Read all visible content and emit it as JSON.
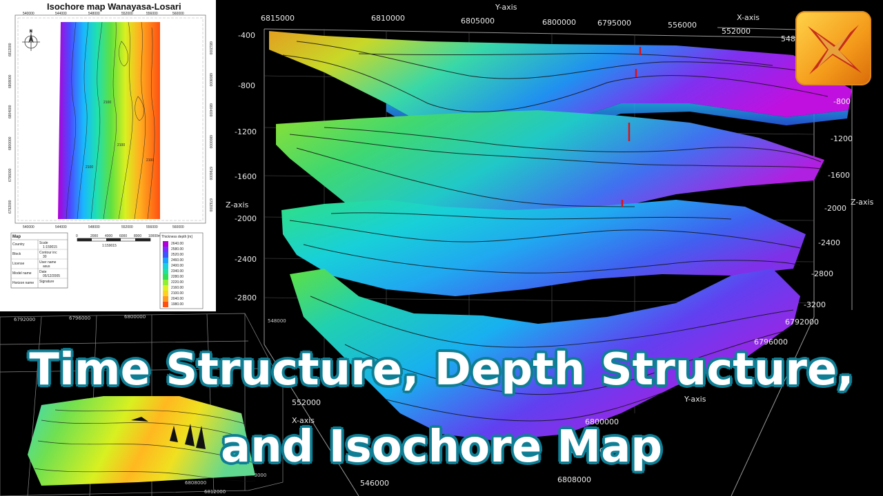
{
  "headline": {
    "line1": "Time Structure, Depth Structure,",
    "line2": "and Isochore Map",
    "fill_color": "#ffffff",
    "stroke_color": "#0f7f95"
  },
  "isochore_map": {
    "title": "Isochore map Wanayasa-Losari",
    "x_ticks": [
      "540000",
      "544000",
      "548000",
      "552000",
      "556000",
      "560000"
    ],
    "y_ticks_left": [
      "6812000",
      "6808000",
      "6804000",
      "6800000",
      "6796000",
      "6792000"
    ],
    "y_ticks_right": [
      "6812000",
      "6808000",
      "6804000",
      "6800000",
      "6796000",
      "6792000"
    ],
    "contour_labels": [
      "2100",
      "2100",
      "2100",
      "2100"
    ],
    "scale_bar": {
      "ticks": [
        "0",
        "2000",
        "4000",
        "6000",
        "8000",
        "10000m"
      ],
      "scale_text": "1:159015"
    },
    "info_table": {
      "heading": "Map",
      "rows": [
        {
          "label": "Country",
          "value": "Scale",
          "sub": "1:159015"
        },
        {
          "label": "Block",
          "value": "Contour inc",
          "sub": "30"
        },
        {
          "label": "License",
          "value": "User name",
          "sub": "asus"
        },
        {
          "label": "Model name",
          "value": "Date",
          "sub": "05/12/2005"
        },
        {
          "label": "Horizon name",
          "value": "Signature",
          "sub": ""
        }
      ]
    },
    "legend": {
      "title": "Thickness depth [m]",
      "values": [
        "2640.00",
        "2580.00",
        "2520.00",
        "2460.00",
        "2400.00",
        "2340.00",
        "2280.00",
        "2220.00",
        "2160.00",
        "2100.00",
        "2040.00",
        "1980.00"
      ],
      "colors": [
        "#b000d8",
        "#7a2bff",
        "#3a55ff",
        "#1aa0ff",
        "#18d0e0",
        "#20e0a0",
        "#30e050",
        "#90f030",
        "#e0f020",
        "#ffd020",
        "#ff9a20",
        "#ff5010"
      ]
    }
  },
  "main_3d": {
    "y_axis_title": "Y-axis",
    "x_axis_title": "X-axis",
    "z_axis_title": "Z-axis",
    "right_z_axis_title": "Z-axis",
    "bottom_x_axis_title": "X-axis",
    "bottom_y_axis_title": "Y-axis",
    "top_y_ticks": [
      "6815000",
      "6810000",
      "6805000",
      "6800000",
      "6795000"
    ],
    "top_x_ticks": [
      "556000",
      "552000",
      "548000"
    ],
    "left_z_ticks": [
      "-400",
      "-800",
      "-1200",
      "-1600",
      "-2000",
      "-2400",
      "-2800"
    ],
    "right_z_ticks": [
      "-800",
      "-1200",
      "-1600",
      "-2000",
      "-2400",
      "-2800",
      "-3200"
    ],
    "right_y_ticks": [
      "6792000",
      "6796000"
    ],
    "bottom_x_ticks": [
      "552000",
      "546000"
    ],
    "bottom_y_ticks": [
      "6800000",
      "6804000",
      "6808000"
    ],
    "axis_color": "#b8b8b8"
  },
  "inset_3d": {
    "top_ticks": [
      "6792000",
      "6796000",
      "6800000"
    ],
    "right_ticks": [
      "548000",
      "-3000"
    ],
    "bottom_ticks": [
      "6808000",
      "6812000"
    ]
  },
  "logo": {
    "icon": "star-burst-logo-icon",
    "colors": [
      "#ffd44a",
      "#f49a1a",
      "#c4261a"
    ]
  }
}
